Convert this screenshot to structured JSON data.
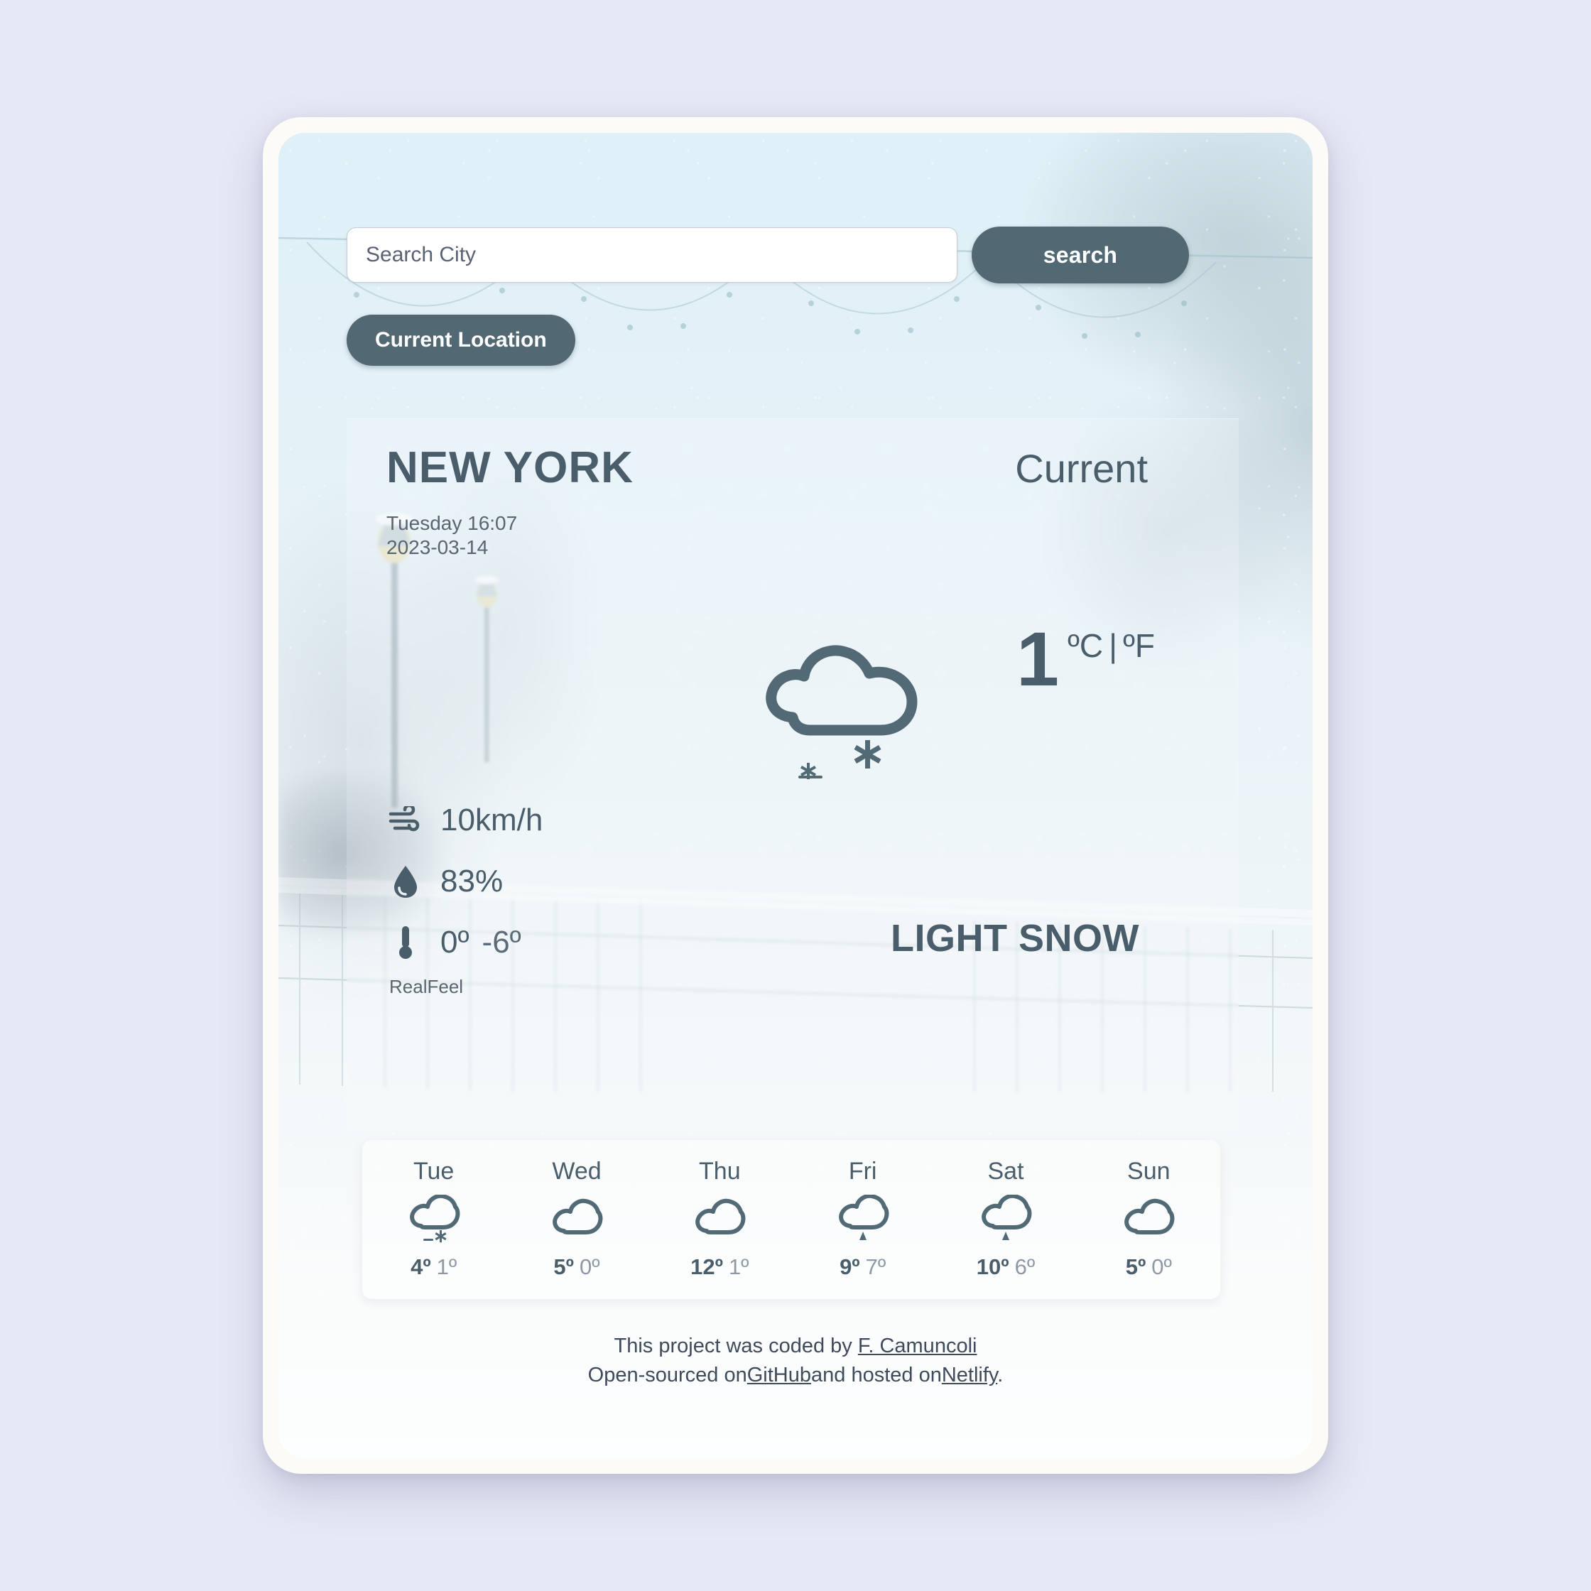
{
  "search": {
    "placeholder": "Search City",
    "value": "",
    "button_label": "search"
  },
  "location_button": {
    "label": "Current Location"
  },
  "current": {
    "city": "NEW YORK",
    "time": "Tuesday 16:07",
    "date": "2023-03-14",
    "panel_label": "Current",
    "temperature": "1",
    "unit_celsius": "ºC",
    "unit_separator": "|",
    "unit_fahrenheit": "ºF",
    "condition": "LIGHT SNOW",
    "icon": "snow-cloud-icon",
    "wind": "10km/h",
    "humidity": "83%",
    "realfeel_high": "0º",
    "realfeel_low": "-6º",
    "realfeel_label": "RealFeel"
  },
  "forecast": [
    {
      "day": "Tue",
      "icon": "snow-cloud-icon",
      "high": "4º",
      "low": "1º"
    },
    {
      "day": "Wed",
      "icon": "cloud-icon",
      "high": "5º",
      "low": "0º"
    },
    {
      "day": "Thu",
      "icon": "cloud-icon",
      "high": "12º",
      "low": "1º"
    },
    {
      "day": "Fri",
      "icon": "rain-cloud-icon",
      "high": "9º",
      "low": "7º"
    },
    {
      "day": "Sat",
      "icon": "rain-cloud-icon",
      "high": "10º",
      "low": "6º"
    },
    {
      "day": "Sun",
      "icon": "cloud-icon",
      "high": "5º",
      "low": "0º"
    }
  ],
  "footer": {
    "line1_prefix": "This project was coded by ",
    "author": "F. Camuncoli",
    "line2_prefix": "Open-sourced on",
    "github": "GitHub",
    "line2_middle": "and hosted on",
    "netlify": "Netlify",
    "line2_suffix": "."
  },
  "colors": {
    "accent": "#526873",
    "text": "#4a5d6b",
    "page_background": "#e6e8f5"
  }
}
